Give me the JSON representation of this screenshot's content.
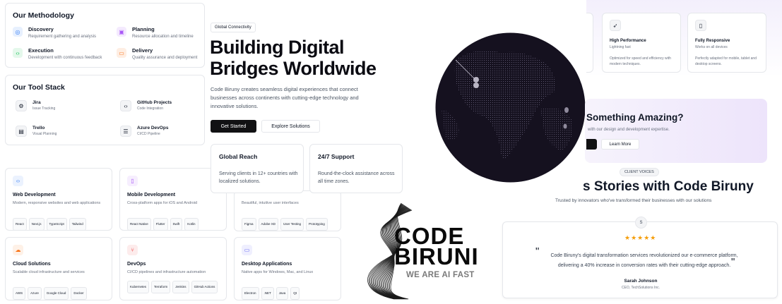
{
  "methodology": {
    "title": "Our Methodology",
    "items": [
      {
        "title": "Discovery",
        "desc": "Requirement gathering and analysis",
        "icon": "target-icon",
        "color": "#3b82f6"
      },
      {
        "title": "Planning",
        "desc": "Resource allocation and timeline",
        "icon": "calendar-icon",
        "color": "#a855f7"
      },
      {
        "title": "Execution",
        "desc": "Development with continuous feedback",
        "icon": "code-icon",
        "color": "#22c55e"
      },
      {
        "title": "Delivery",
        "desc": "Quality assurance and deployment",
        "icon": "package-icon",
        "color": "#f97316"
      }
    ]
  },
  "toolstack": {
    "title": "Our Tool Stack",
    "items": [
      {
        "name": "Jira",
        "desc": "Issue Tracking",
        "icon": "gear-icon"
      },
      {
        "name": "GitHub Projects",
        "desc": "Code Integration",
        "icon": "code-icon"
      },
      {
        "name": "Trello",
        "desc": "Visual Planning",
        "icon": "board-icon"
      },
      {
        "name": "Azure DevOps",
        "desc": "CI/CD Pipeline",
        "icon": "server-icon"
      }
    ]
  },
  "services": [
    {
      "title": "Web Development",
      "desc": "Modern, responsive websites and web applications",
      "tags": [
        "React",
        "Next.js",
        "TypeScript",
        "Tailwind"
      ],
      "icon": "code-icon",
      "color": "#3b82f6"
    },
    {
      "title": "Mobile Development",
      "desc": "Cross-platform apps for iOS and Android",
      "tags": [
        "React Native",
        "Flutter",
        "Swift",
        "Kotlin"
      ],
      "icon": "phone-icon",
      "color": "#a855f7"
    },
    {
      "title": "",
      "desc": "Beautiful, intuitive user interfaces",
      "tags": [
        "Figma",
        "Adobe XD",
        "User Testing",
        "Prototyping"
      ],
      "icon": "",
      "color": "#ec4899"
    },
    {
      "title": "Cloud Solutions",
      "desc": "Scalable cloud infrastructure and services",
      "tags": [
        "AWS",
        "Azure",
        "Google Cloud",
        "Docker"
      ],
      "icon": "cloud-icon",
      "color": "#f97316"
    },
    {
      "title": "DevOps",
      "desc": "CI/CD pipelines and infrastructure automation",
      "tags": [
        "Kubernetes",
        "Terraform",
        "Jenkins",
        "GitHub Actions"
      ],
      "icon": "branch-icon",
      "color": "#ef4444"
    },
    {
      "title": "Desktop Applications",
      "desc": "Native apps for Windows, Mac, and Linux",
      "tags": [
        "Electron",
        ".NET",
        "Java",
        "Qt"
      ],
      "icon": "monitor-icon",
      "color": "#6366f1"
    }
  ],
  "hero": {
    "badge": "Global Connectivity",
    "title_line1": "Building Digital",
    "title_line2": "Bridges Worldwide",
    "subtitle": "Code Biruny creates seamless digital experiences that connect businesses across continents with cutting-edge technology and innovative solutions.",
    "primary_btn": "Get Started",
    "secondary_btn": "Explore Solutions",
    "cards": [
      {
        "title": "Global Reach",
        "desc": "Serving clients in 12+ countries with localized solutions."
      },
      {
        "title": "24/7 Support",
        "desc": "Round-the-clock assistance across all time zones."
      }
    ]
  },
  "features": [
    {
      "title": "High Performance",
      "sub": "Lightning fast",
      "desc": "Optimized for speed and efficiency with modern techniques.",
      "icon": "rocket-icon"
    },
    {
      "title": "Fully Responsive",
      "sub": "Works on all devices",
      "desc": "Perfectly adapted for mobile, tablet and desktop screens.",
      "icon": "phone-icon"
    }
  ],
  "cta": {
    "title": "Something Amazing?",
    "desc": "with our design and development expertise.",
    "btn": "Learn More"
  },
  "testimonials": {
    "badge": "CLIENT VOICES",
    "title": "s Stories with Code Biruny",
    "subtitle": "Trusted by innovators who've transformed their businesses with our solutions",
    "avatar": "S",
    "stars": "★★★★★",
    "quote": "Code Biruny's digital transformation services revolutionized our e-commerce platform, delivering a 40% increase in conversion rates with their cutting-edge approach.",
    "author": "Sarah Johnson",
    "role": "CEO, TechSolutions Inc."
  },
  "logo": {
    "line1": "CODE",
    "line2": "BIRUNI",
    "tagline": "WE ARE AI FAST"
  }
}
